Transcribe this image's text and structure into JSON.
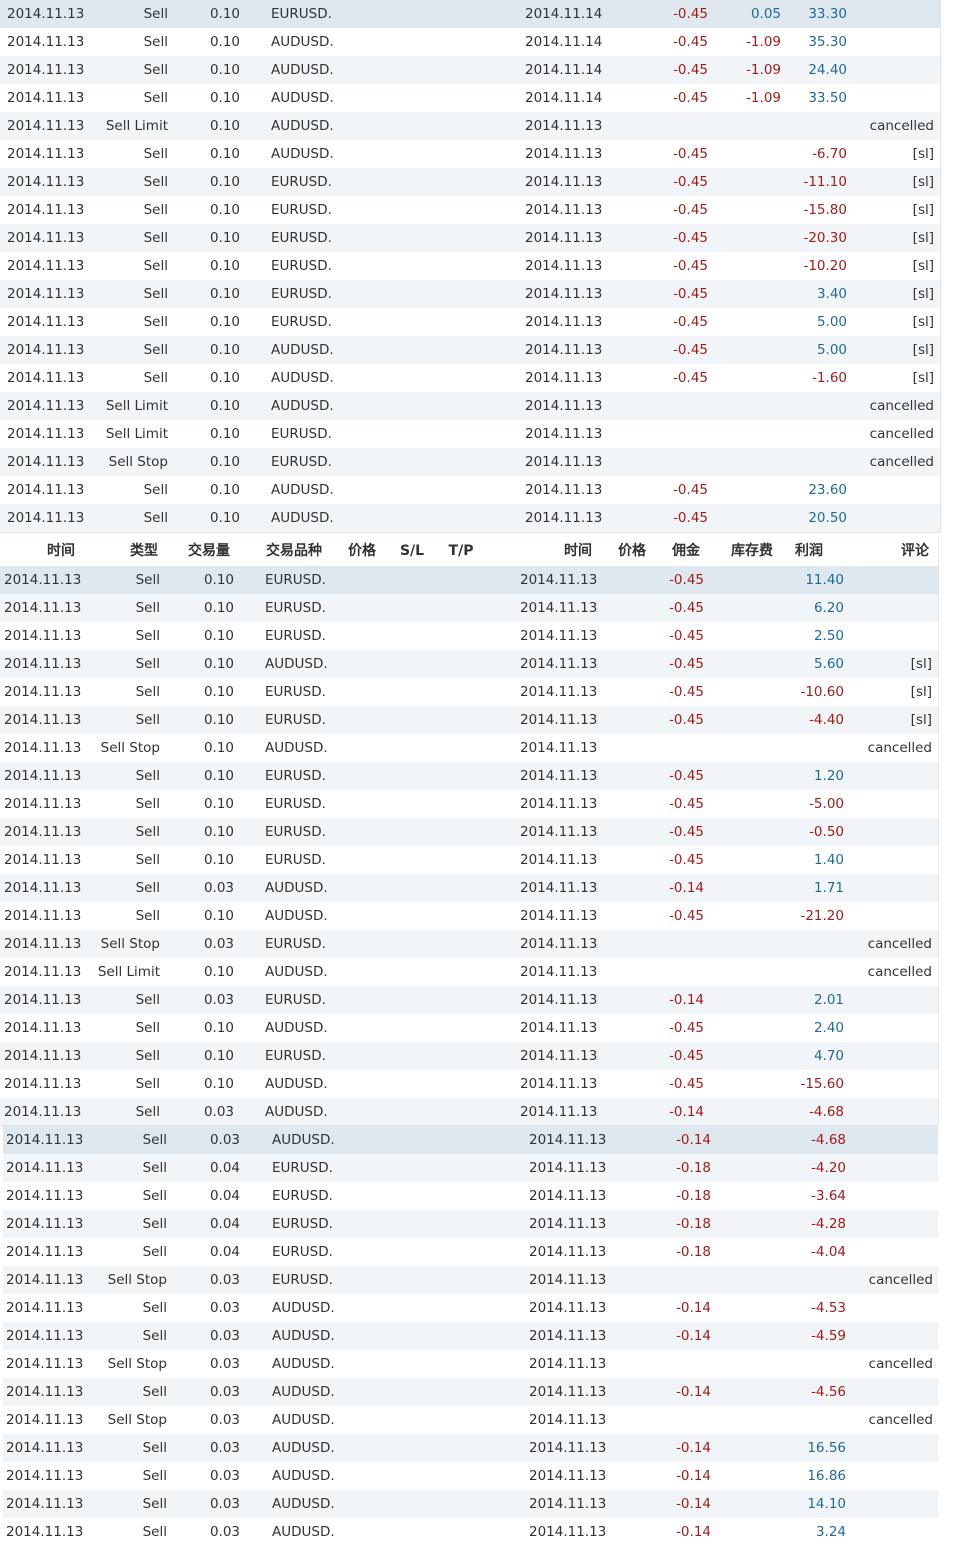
{
  "header": {
    "open_time": "时间",
    "type": "类型",
    "lots": "交易量",
    "symbol": "交易品种",
    "open_price": "价格",
    "sl": "S/L",
    "tp": "T/P",
    "close_time": "时间",
    "close_price": "价格",
    "commission": "佣金",
    "swap": "库存费",
    "profit": "利润",
    "comment": "评论"
  },
  "section1_rows": [
    {
      "open_time": "2014.11.13",
      "type": "Sell",
      "lots": "0.10",
      "symbol": "EURUSD.",
      "close_time": "2014.11.14",
      "commission": "-0.45",
      "swap": "0.05",
      "profit": "33.30",
      "comment": ""
    },
    {
      "open_time": "2014.11.13",
      "type": "Sell",
      "lots": "0.10",
      "symbol": "AUDUSD.",
      "close_time": "2014.11.14",
      "commission": "-0.45",
      "swap": "-1.09",
      "profit": "35.30",
      "comment": ""
    },
    {
      "open_time": "2014.11.13",
      "type": "Sell",
      "lots": "0.10",
      "symbol": "AUDUSD.",
      "close_time": "2014.11.14",
      "commission": "-0.45",
      "swap": "-1.09",
      "profit": "24.40",
      "comment": ""
    },
    {
      "open_time": "2014.11.13",
      "type": "Sell",
      "lots": "0.10",
      "symbol": "AUDUSD.",
      "close_time": "2014.11.14",
      "commission": "-0.45",
      "swap": "-1.09",
      "profit": "33.50",
      "comment": ""
    },
    {
      "open_time": "2014.11.13",
      "type": "Sell Limit",
      "lots": "0.10",
      "symbol": "AUDUSD.",
      "close_time": "2014.11.13",
      "commission": "",
      "swap": "",
      "profit": "",
      "comment": "cancelled"
    },
    {
      "open_time": "2014.11.13",
      "type": "Sell",
      "lots": "0.10",
      "symbol": "AUDUSD.",
      "close_time": "2014.11.13",
      "commission": "-0.45",
      "swap": "",
      "profit": "-6.70",
      "comment": "[sl]"
    },
    {
      "open_time": "2014.11.13",
      "type": "Sell",
      "lots": "0.10",
      "symbol": "EURUSD.",
      "close_time": "2014.11.13",
      "commission": "-0.45",
      "swap": "",
      "profit": "-11.10",
      "comment": "[sl]"
    },
    {
      "open_time": "2014.11.13",
      "type": "Sell",
      "lots": "0.10",
      "symbol": "EURUSD.",
      "close_time": "2014.11.13",
      "commission": "-0.45",
      "swap": "",
      "profit": "-15.80",
      "comment": "[sl]"
    },
    {
      "open_time": "2014.11.13",
      "type": "Sell",
      "lots": "0.10",
      "symbol": "EURUSD.",
      "close_time": "2014.11.13",
      "commission": "-0.45",
      "swap": "",
      "profit": "-20.30",
      "comment": "[sl]"
    },
    {
      "open_time": "2014.11.13",
      "type": "Sell",
      "lots": "0.10",
      "symbol": "EURUSD.",
      "close_time": "2014.11.13",
      "commission": "-0.45",
      "swap": "",
      "profit": "-10.20",
      "comment": "[sl]"
    },
    {
      "open_time": "2014.11.13",
      "type": "Sell",
      "lots": "0.10",
      "symbol": "EURUSD.",
      "close_time": "2014.11.13",
      "commission": "-0.45",
      "swap": "",
      "profit": "3.40",
      "comment": "[sl]"
    },
    {
      "open_time": "2014.11.13",
      "type": "Sell",
      "lots": "0.10",
      "symbol": "EURUSD.",
      "close_time": "2014.11.13",
      "commission": "-0.45",
      "swap": "",
      "profit": "5.00",
      "comment": "[sl]"
    },
    {
      "open_time": "2014.11.13",
      "type": "Sell",
      "lots": "0.10",
      "symbol": "AUDUSD.",
      "close_time": "2014.11.13",
      "commission": "-0.45",
      "swap": "",
      "profit": "5.00",
      "comment": "[sl]"
    },
    {
      "open_time": "2014.11.13",
      "type": "Sell",
      "lots": "0.10",
      "symbol": "AUDUSD.",
      "close_time": "2014.11.13",
      "commission": "-0.45",
      "swap": "",
      "profit": "-1.60",
      "comment": "[sl]"
    },
    {
      "open_time": "2014.11.13",
      "type": "Sell Limit",
      "lots": "0.10",
      "symbol": "AUDUSD.",
      "close_time": "2014.11.13",
      "commission": "",
      "swap": "",
      "profit": "",
      "comment": "cancelled"
    },
    {
      "open_time": "2014.11.13",
      "type": "Sell Limit",
      "lots": "0.10",
      "symbol": "EURUSD.",
      "close_time": "2014.11.13",
      "commission": "",
      "swap": "",
      "profit": "",
      "comment": "cancelled"
    },
    {
      "open_time": "2014.11.13",
      "type": "Sell Stop",
      "lots": "0.10",
      "symbol": "EURUSD.",
      "close_time": "2014.11.13",
      "commission": "",
      "swap": "",
      "profit": "",
      "comment": "cancelled"
    },
    {
      "open_time": "2014.11.13",
      "type": "Sell",
      "lots": "0.10",
      "symbol": "AUDUSD.",
      "close_time": "2014.11.13",
      "commission": "-0.45",
      "swap": "",
      "profit": "23.60",
      "comment": ""
    },
    {
      "open_time": "2014.11.13",
      "type": "Sell",
      "lots": "0.10",
      "symbol": "AUDUSD.",
      "close_time": "2014.11.13",
      "commission": "-0.45",
      "swap": "",
      "profit": "20.50",
      "comment": ""
    }
  ],
  "section2_rows": [
    {
      "open_time": "2014.11.13",
      "type": "Sell",
      "lots": "0.10",
      "symbol": "EURUSD.",
      "close_time": "2014.11.13",
      "commission": "-0.45",
      "swap": "",
      "profit": "11.40",
      "comment": ""
    },
    {
      "open_time": "2014.11.13",
      "type": "Sell",
      "lots": "0.10",
      "symbol": "EURUSD.",
      "close_time": "2014.11.13",
      "commission": "-0.45",
      "swap": "",
      "profit": "6.20",
      "comment": ""
    },
    {
      "open_time": "2014.11.13",
      "type": "Sell",
      "lots": "0.10",
      "symbol": "EURUSD.",
      "close_time": "2014.11.13",
      "commission": "-0.45",
      "swap": "",
      "profit": "2.50",
      "comment": ""
    },
    {
      "open_time": "2014.11.13",
      "type": "Sell",
      "lots": "0.10",
      "symbol": "AUDUSD.",
      "close_time": "2014.11.13",
      "commission": "-0.45",
      "swap": "",
      "profit": "5.60",
      "comment": "[sl]"
    },
    {
      "open_time": "2014.11.13",
      "type": "Sell",
      "lots": "0.10",
      "symbol": "EURUSD.",
      "close_time": "2014.11.13",
      "commission": "-0.45",
      "swap": "",
      "profit": "-10.60",
      "comment": "[sl]"
    },
    {
      "open_time": "2014.11.13",
      "type": "Sell",
      "lots": "0.10",
      "symbol": "EURUSD.",
      "close_time": "2014.11.13",
      "commission": "-0.45",
      "swap": "",
      "profit": "-4.40",
      "comment": "[sl]"
    },
    {
      "open_time": "2014.11.13",
      "type": "Sell Stop",
      "lots": "0.10",
      "symbol": "AUDUSD.",
      "close_time": "2014.11.13",
      "commission": "",
      "swap": "",
      "profit": "",
      "comment": "cancelled"
    },
    {
      "open_time": "2014.11.13",
      "type": "Sell",
      "lots": "0.10",
      "symbol": "EURUSD.",
      "close_time": "2014.11.13",
      "commission": "-0.45",
      "swap": "",
      "profit": "1.20",
      "comment": ""
    },
    {
      "open_time": "2014.11.13",
      "type": "Sell",
      "lots": "0.10",
      "symbol": "EURUSD.",
      "close_time": "2014.11.13",
      "commission": "-0.45",
      "swap": "",
      "profit": "-5.00",
      "comment": ""
    },
    {
      "open_time": "2014.11.13",
      "type": "Sell",
      "lots": "0.10",
      "symbol": "EURUSD.",
      "close_time": "2014.11.13",
      "commission": "-0.45",
      "swap": "",
      "profit": "-0.50",
      "comment": ""
    },
    {
      "open_time": "2014.11.13",
      "type": "Sell",
      "lots": "0.10",
      "symbol": "EURUSD.",
      "close_time": "2014.11.13",
      "commission": "-0.45",
      "swap": "",
      "profit": "1.40",
      "comment": ""
    },
    {
      "open_time": "2014.11.13",
      "type": "Sell",
      "lots": "0.03",
      "symbol": "AUDUSD.",
      "close_time": "2014.11.13",
      "commission": "-0.14",
      "swap": "",
      "profit": "1.71",
      "comment": ""
    },
    {
      "open_time": "2014.11.13",
      "type": "Sell",
      "lots": "0.10",
      "symbol": "AUDUSD.",
      "close_time": "2014.11.13",
      "commission": "-0.45",
      "swap": "",
      "profit": "-21.20",
      "comment": ""
    },
    {
      "open_time": "2014.11.13",
      "type": "Sell Stop",
      "lots": "0.03",
      "symbol": "EURUSD.",
      "close_time": "2014.11.13",
      "commission": "",
      "swap": "",
      "profit": "",
      "comment": "cancelled"
    },
    {
      "open_time": "2014.11.13",
      "type": "Sell Limit",
      "lots": "0.10",
      "symbol": "AUDUSD.",
      "close_time": "2014.11.13",
      "commission": "",
      "swap": "",
      "profit": "",
      "comment": "cancelled"
    },
    {
      "open_time": "2014.11.13",
      "type": "Sell",
      "lots": "0.03",
      "symbol": "EURUSD.",
      "close_time": "2014.11.13",
      "commission": "-0.14",
      "swap": "",
      "profit": "2.01",
      "comment": ""
    },
    {
      "open_time": "2014.11.13",
      "type": "Sell",
      "lots": "0.10",
      "symbol": "AUDUSD.",
      "close_time": "2014.11.13",
      "commission": "-0.45",
      "swap": "",
      "profit": "2.40",
      "comment": ""
    },
    {
      "open_time": "2014.11.13",
      "type": "Sell",
      "lots": "0.10",
      "symbol": "EURUSD.",
      "close_time": "2014.11.13",
      "commission": "-0.45",
      "swap": "",
      "profit": "4.70",
      "comment": ""
    },
    {
      "open_time": "2014.11.13",
      "type": "Sell",
      "lots": "0.10",
      "symbol": "AUDUSD.",
      "close_time": "2014.11.13",
      "commission": "-0.45",
      "swap": "",
      "profit": "-15.60",
      "comment": ""
    },
    {
      "open_time": "2014.11.13",
      "type": "Sell",
      "lots": "0.03",
      "symbol": "AUDUSD.",
      "close_time": "2014.11.13",
      "commission": "-0.14",
      "swap": "",
      "profit": "-4.68",
      "comment": ""
    }
  ],
  "section3_rows": [
    {
      "open_time": "2014.11.13",
      "type": "Sell",
      "lots": "0.03",
      "symbol": "AUDUSD.",
      "close_time": "2014.11.13",
      "commission": "-0.14",
      "swap": "",
      "profit": "-4.68",
      "comment": ""
    },
    {
      "open_time": "2014.11.13",
      "type": "Sell",
      "lots": "0.04",
      "symbol": "EURUSD.",
      "close_time": "2014.11.13",
      "commission": "-0.18",
      "swap": "",
      "profit": "-4.20",
      "comment": ""
    },
    {
      "open_time": "2014.11.13",
      "type": "Sell",
      "lots": "0.04",
      "symbol": "EURUSD.",
      "close_time": "2014.11.13",
      "commission": "-0.18",
      "swap": "",
      "profit": "-3.64",
      "comment": ""
    },
    {
      "open_time": "2014.11.13",
      "type": "Sell",
      "lots": "0.04",
      "symbol": "EURUSD.",
      "close_time": "2014.11.13",
      "commission": "-0.18",
      "swap": "",
      "profit": "-4.28",
      "comment": ""
    },
    {
      "open_time": "2014.11.13",
      "type": "Sell",
      "lots": "0.04",
      "symbol": "EURUSD.",
      "close_time": "2014.11.13",
      "commission": "-0.18",
      "swap": "",
      "profit": "-4.04",
      "comment": ""
    },
    {
      "open_time": "2014.11.13",
      "type": "Sell Stop",
      "lots": "0.03",
      "symbol": "EURUSD.",
      "close_time": "2014.11.13",
      "commission": "",
      "swap": "",
      "profit": "",
      "comment": "cancelled"
    },
    {
      "open_time": "2014.11.13",
      "type": "Sell",
      "lots": "0.03",
      "symbol": "AUDUSD.",
      "close_time": "2014.11.13",
      "commission": "-0.14",
      "swap": "",
      "profit": "-4.53",
      "comment": ""
    },
    {
      "open_time": "2014.11.13",
      "type": "Sell",
      "lots": "0.03",
      "symbol": "AUDUSD.",
      "close_time": "2014.11.13",
      "commission": "-0.14",
      "swap": "",
      "profit": "-4.59",
      "comment": ""
    },
    {
      "open_time": "2014.11.13",
      "type": "Sell Stop",
      "lots": "0.03",
      "symbol": "AUDUSD.",
      "close_time": "2014.11.13",
      "commission": "",
      "swap": "",
      "profit": "",
      "comment": "cancelled"
    },
    {
      "open_time": "2014.11.13",
      "type": "Sell",
      "lots": "0.03",
      "symbol": "AUDUSD.",
      "close_time": "2014.11.13",
      "commission": "-0.14",
      "swap": "",
      "profit": "-4.56",
      "comment": ""
    },
    {
      "open_time": "2014.11.13",
      "type": "Sell Stop",
      "lots": "0.03",
      "symbol": "AUDUSD.",
      "close_time": "2014.11.13",
      "commission": "",
      "swap": "",
      "profit": "",
      "comment": "cancelled"
    },
    {
      "open_time": "2014.11.13",
      "type": "Sell",
      "lots": "0.03",
      "symbol": "AUDUSD.",
      "close_time": "2014.11.13",
      "commission": "-0.14",
      "swap": "",
      "profit": "16.56",
      "comment": ""
    },
    {
      "open_time": "2014.11.13",
      "type": "Sell",
      "lots": "0.03",
      "symbol": "AUDUSD.",
      "close_time": "2014.11.13",
      "commission": "-0.14",
      "swap": "",
      "profit": "16.86",
      "comment": ""
    },
    {
      "open_time": "2014.11.13",
      "type": "Sell",
      "lots": "0.03",
      "symbol": "AUDUSD.",
      "close_time": "2014.11.13",
      "commission": "-0.14",
      "swap": "",
      "profit": "14.10",
      "comment": ""
    },
    {
      "open_time": "2014.11.13",
      "type": "Sell",
      "lots": "0.03",
      "symbol": "AUDUSD.",
      "close_time": "2014.11.13",
      "commission": "-0.14",
      "swap": "",
      "profit": "3.24",
      "comment": ""
    }
  ],
  "colors": {
    "negative": "#a31c1c",
    "positive": "#1f6a9a",
    "alt_row": "#f2f5f8",
    "highlighted_row": "#dfe7ef"
  }
}
